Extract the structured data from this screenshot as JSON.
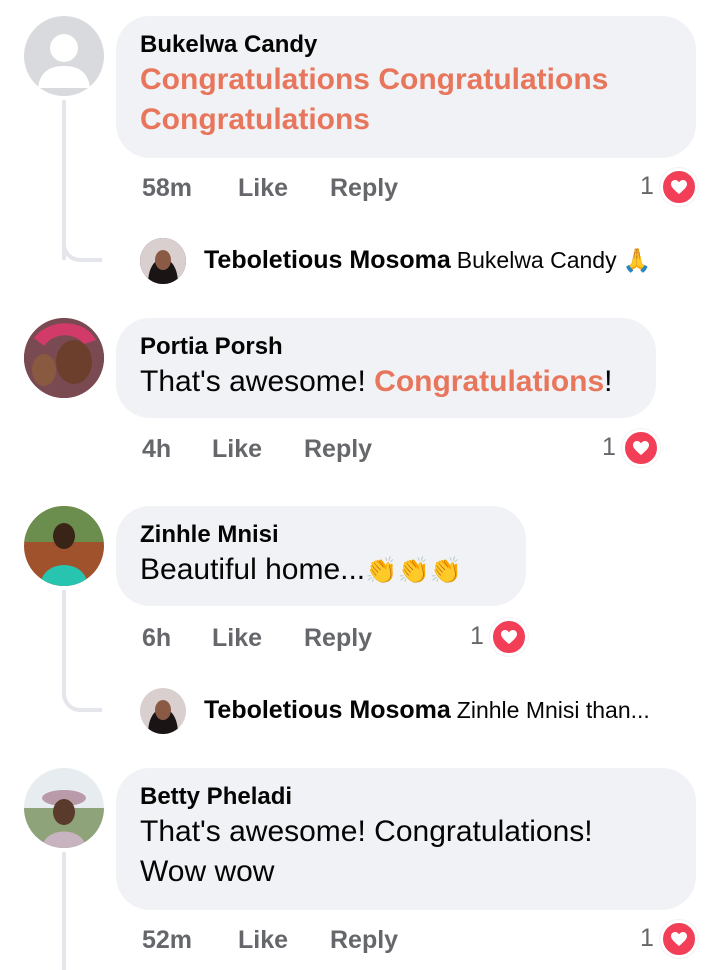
{
  "comments": [
    {
      "author": "Bukelwa Candy",
      "text_parts": [
        "Congratulations Congratulations",
        "Congratulations"
      ],
      "time": "58m",
      "like": "Like",
      "reply": "Reply",
      "reactions": "1",
      "avatar_icon": "default-avatar-icon",
      "reply_preview": {
        "author": "Teboletious Mosoma",
        "text": "Bukelwa Candy",
        "emoji": "🙏"
      }
    },
    {
      "author": "Portia Porsh",
      "text_before": "That's awesome! ",
      "text_highlight": "Congratulations",
      "text_after": "!",
      "time": "4h",
      "like": "Like",
      "reply": "Reply",
      "reactions": "1"
    },
    {
      "author": "Zinhle Mnisi",
      "text": "Beautiful home...",
      "emoji": "👏👏👏",
      "time": "6h",
      "like": "Like",
      "reply": "Reply",
      "reactions": "1",
      "reply_preview": {
        "author": "Teboletious Mosoma",
        "text": "Zinhle Mnisi than..."
      }
    },
    {
      "author": "Betty Pheladi",
      "text_lines": [
        "That's awesome! Congratulations!",
        "Wow wow"
      ],
      "time": "52m",
      "like": "Like",
      "reply": "Reply",
      "reactions": "1"
    }
  ],
  "colors": {
    "bubble": "#f0f2f5",
    "highlight": "#e8765c",
    "meta": "#65676b",
    "heart": "#f33e58",
    "thread_line": "#e4e6eb"
  }
}
